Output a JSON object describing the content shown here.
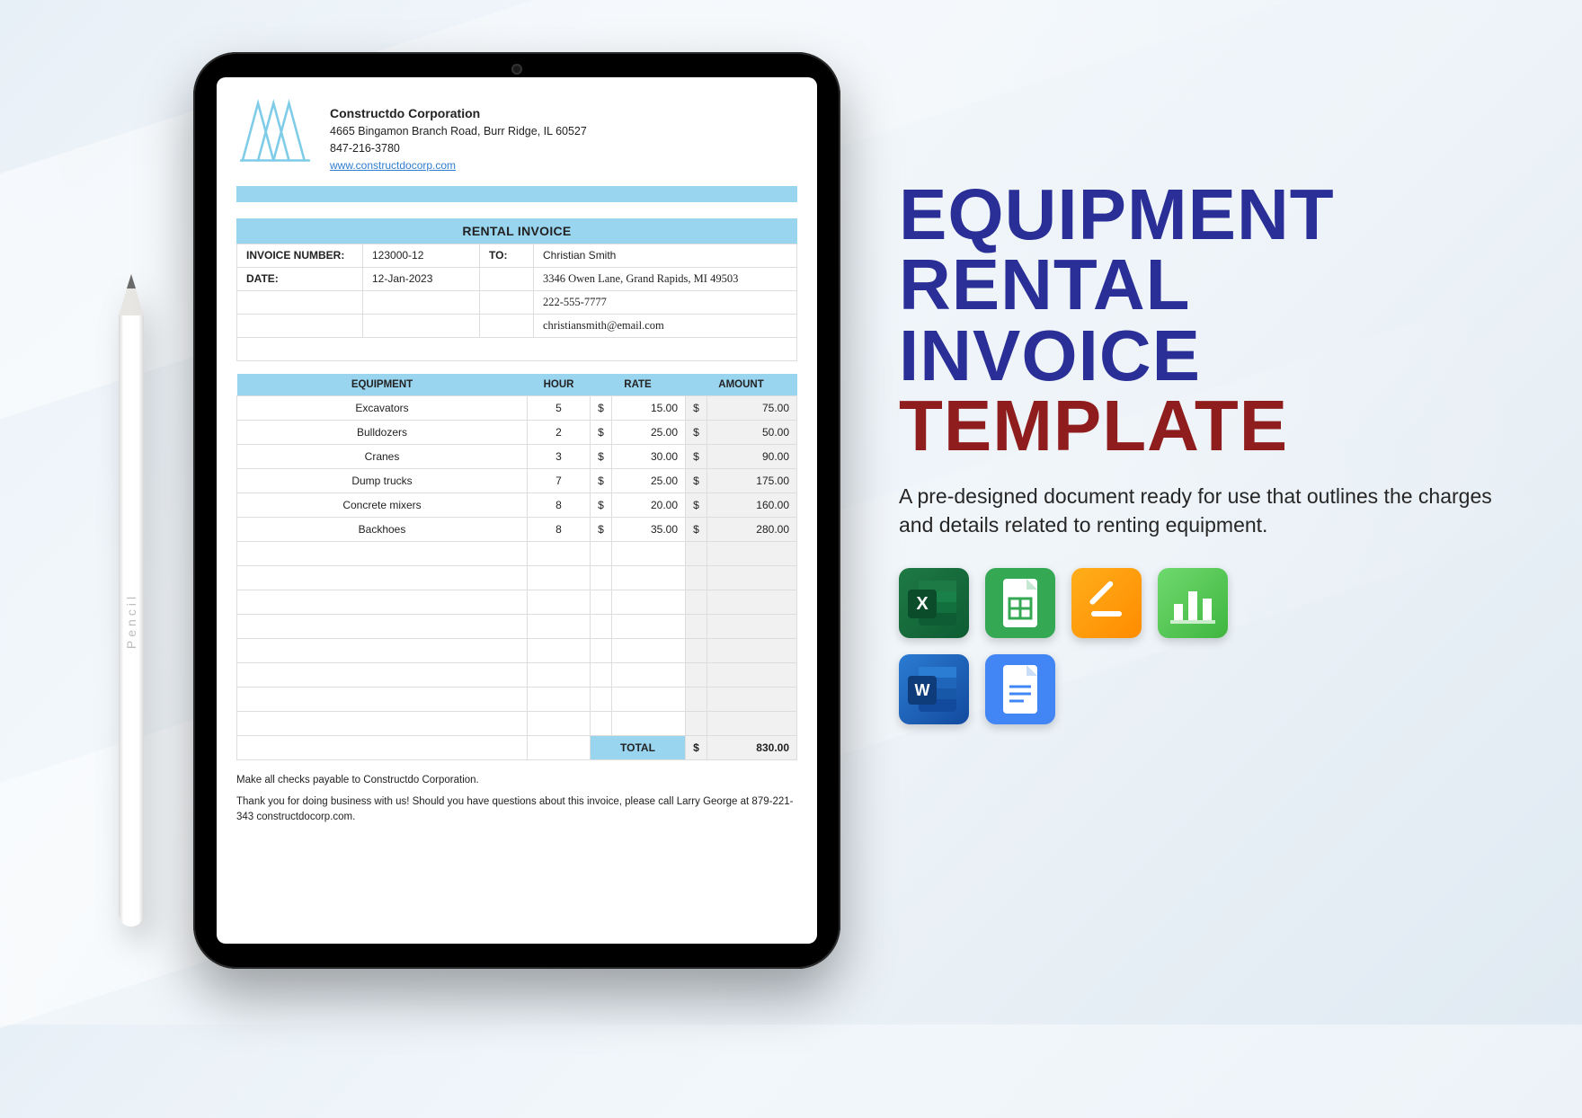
{
  "hero": {
    "title_line1": "EQUIPMENT",
    "title_line2": "RENTAL",
    "title_line3": "INVOICE",
    "title_line4": "TEMPLATE",
    "description": "A pre-designed document ready for use that outlines the charges and details related to renting equipment."
  },
  "apps": {
    "excel": "Microsoft Excel",
    "sheets": "Google Sheets",
    "pages": "Apple Pages",
    "numbers": "Apple Numbers",
    "word": "Microsoft Word",
    "docs": "Google Docs"
  },
  "pencil_label": "Pencil",
  "invoice": {
    "company": {
      "name": "Constructdo Corporation",
      "address": "4665  Bingamon Branch Road, Burr Ridge, IL 60527",
      "phone": "847-216-3780",
      "website": "www.constructdocorp.com"
    },
    "section_title": "RENTAL INVOICE",
    "labels": {
      "invoice_number": "INVOICE NUMBER:",
      "date": "DATE:",
      "to": "TO:"
    },
    "invoice_number": "123000-12",
    "date": "12-Jan-2023",
    "bill_to": {
      "name": "Christian Smith",
      "address": "3346 Owen Lane, Grand Rapids, MI 49503",
      "phone": "222-555-7777",
      "email": "christiansmith@email.com"
    },
    "columns": {
      "equipment": "EQUIPMENT",
      "hour": "HOUR",
      "rate": "RATE",
      "amount": "AMOUNT"
    },
    "currency": "$",
    "items": [
      {
        "equipment": "Excavators",
        "hour": "5",
        "rate": "15.00",
        "amount": "75.00"
      },
      {
        "equipment": "Bulldozers",
        "hour": "2",
        "rate": "25.00",
        "amount": "50.00"
      },
      {
        "equipment": "Cranes",
        "hour": "3",
        "rate": "30.00",
        "amount": "90.00"
      },
      {
        "equipment": "Dump trucks",
        "hour": "7",
        "rate": "25.00",
        "amount": "175.00"
      },
      {
        "equipment": "Concrete mixers",
        "hour": "8",
        "rate": "20.00",
        "amount": "160.00"
      },
      {
        "equipment": "Backhoes",
        "hour": "8",
        "rate": "35.00",
        "amount": "280.00"
      }
    ],
    "blank_rows": 8,
    "total_label": "TOTAL",
    "total": "830.00",
    "notes": {
      "payable": "Make all checks payable to Constructdo Corporation.",
      "thanks": "Thank you for doing business with us! Should you have questions about this invoice, please call Larry George at 879-221-343 constructdocorp.com."
    }
  }
}
